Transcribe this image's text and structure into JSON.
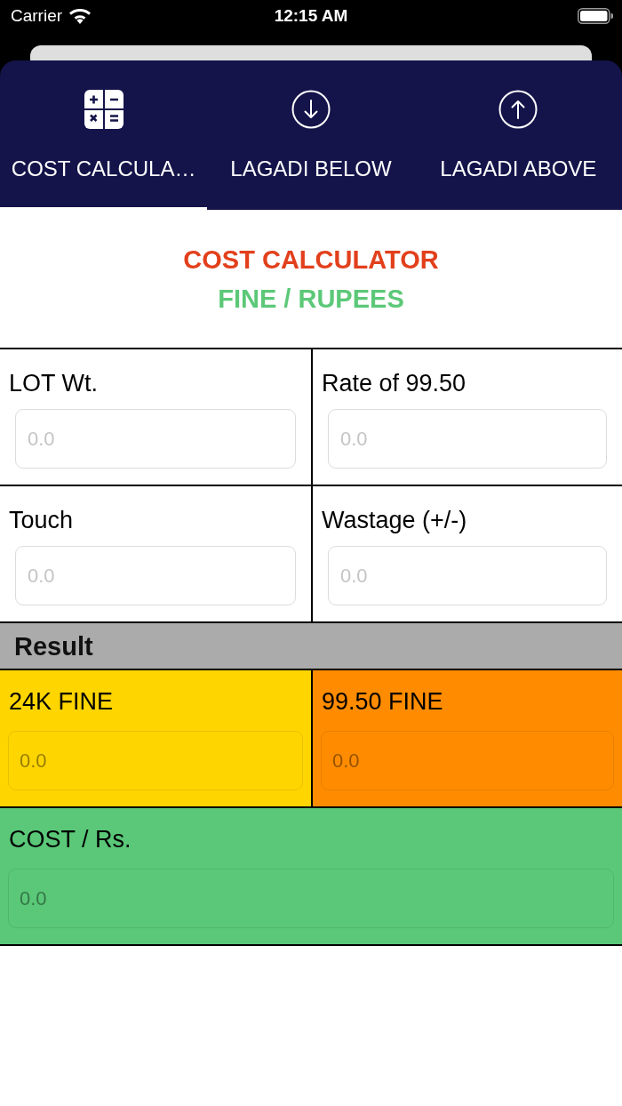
{
  "status_bar": {
    "carrier": "Carrier",
    "time": "12:15 AM"
  },
  "tabs": [
    {
      "kind": "calculator",
      "label": "COST CALCULA…",
      "selected": true
    },
    {
      "kind": "below",
      "label": "LAGADI BELOW",
      "selected": false
    },
    {
      "kind": "above",
      "label": "LAGADI ABOVE",
      "selected": false
    }
  ],
  "header": {
    "title": "COST CALCULATOR",
    "subtitle": "FINE / RUPEES"
  },
  "inputs": [
    {
      "label": "LOT Wt.",
      "placeholder": "0.0"
    },
    {
      "label": "Rate of 99.50",
      "placeholder": "0.0"
    },
    {
      "label": "Touch",
      "placeholder": "0.0"
    },
    {
      "label": "Wastage (+/-)",
      "placeholder": "0.0"
    }
  ],
  "result": {
    "title": "Result",
    "fields": [
      {
        "label": "24K FINE",
        "placeholder": "0.0",
        "color": "#ffd500"
      },
      {
        "label": "99.50 FINE",
        "placeholder": "0.0",
        "color": "#ff8c00"
      },
      {
        "label": "COST / Rs.",
        "placeholder": "0.0",
        "color": "#5ac878"
      }
    ]
  }
}
